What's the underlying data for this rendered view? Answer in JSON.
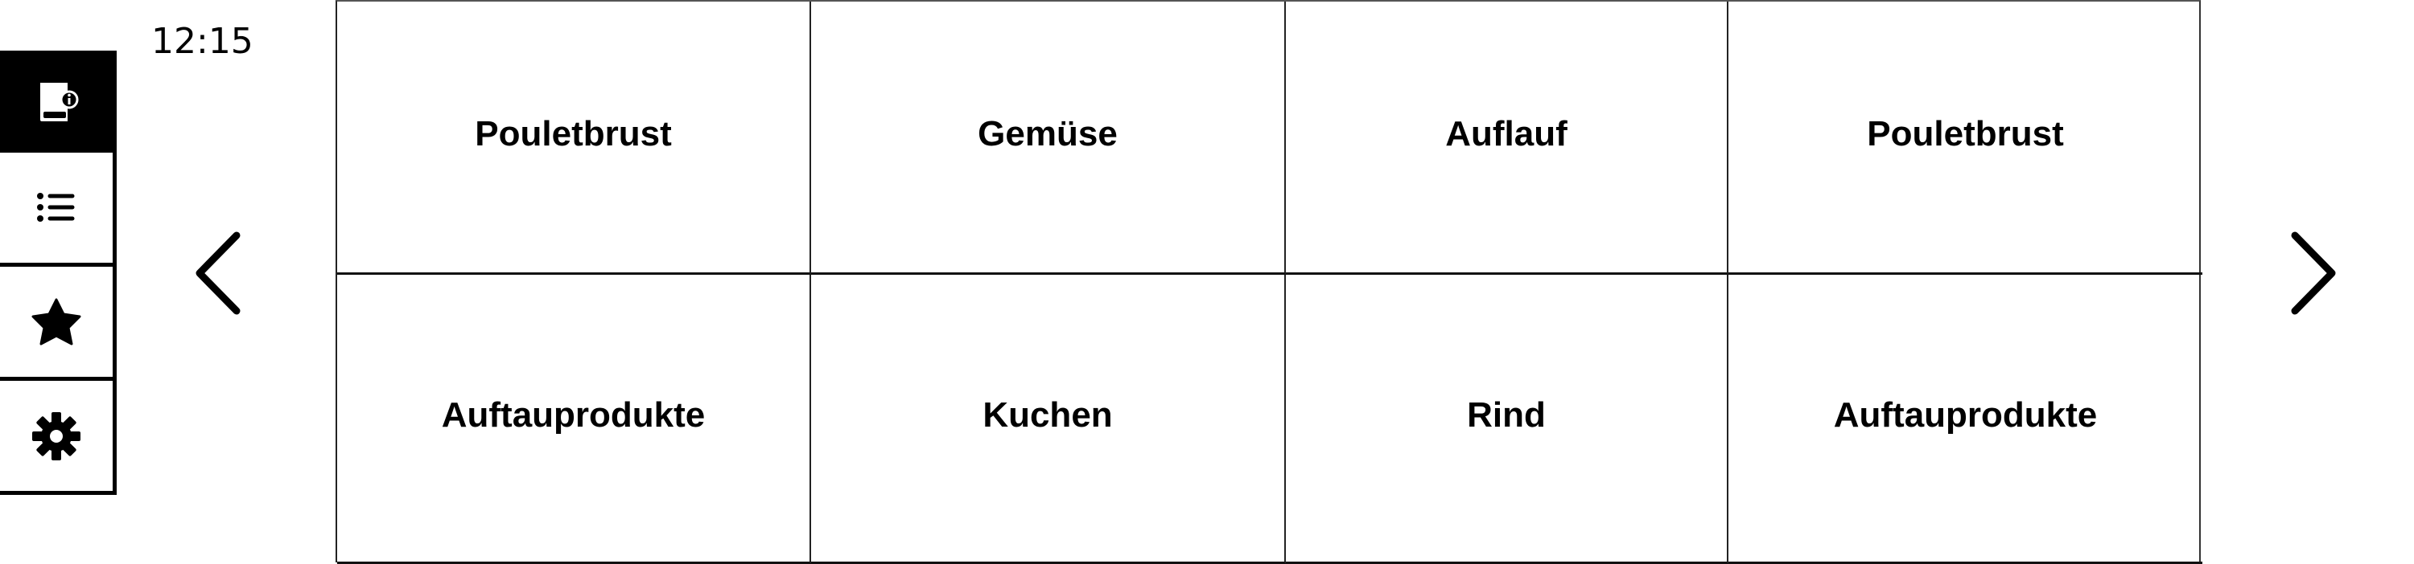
{
  "status": {
    "time": "12:15"
  },
  "sidebar": {
    "items": [
      {
        "name": "recipe-book-info",
        "active": true
      },
      {
        "name": "list"
      },
      {
        "name": "favorites"
      },
      {
        "name": "settings"
      }
    ]
  },
  "categories": [
    "Pouletbrust",
    "Gemüse",
    "Auflauf",
    "Pouletbrust",
    "Auftauprodukte",
    "Kuchen",
    "Rind",
    "Auftauprodukte"
  ]
}
